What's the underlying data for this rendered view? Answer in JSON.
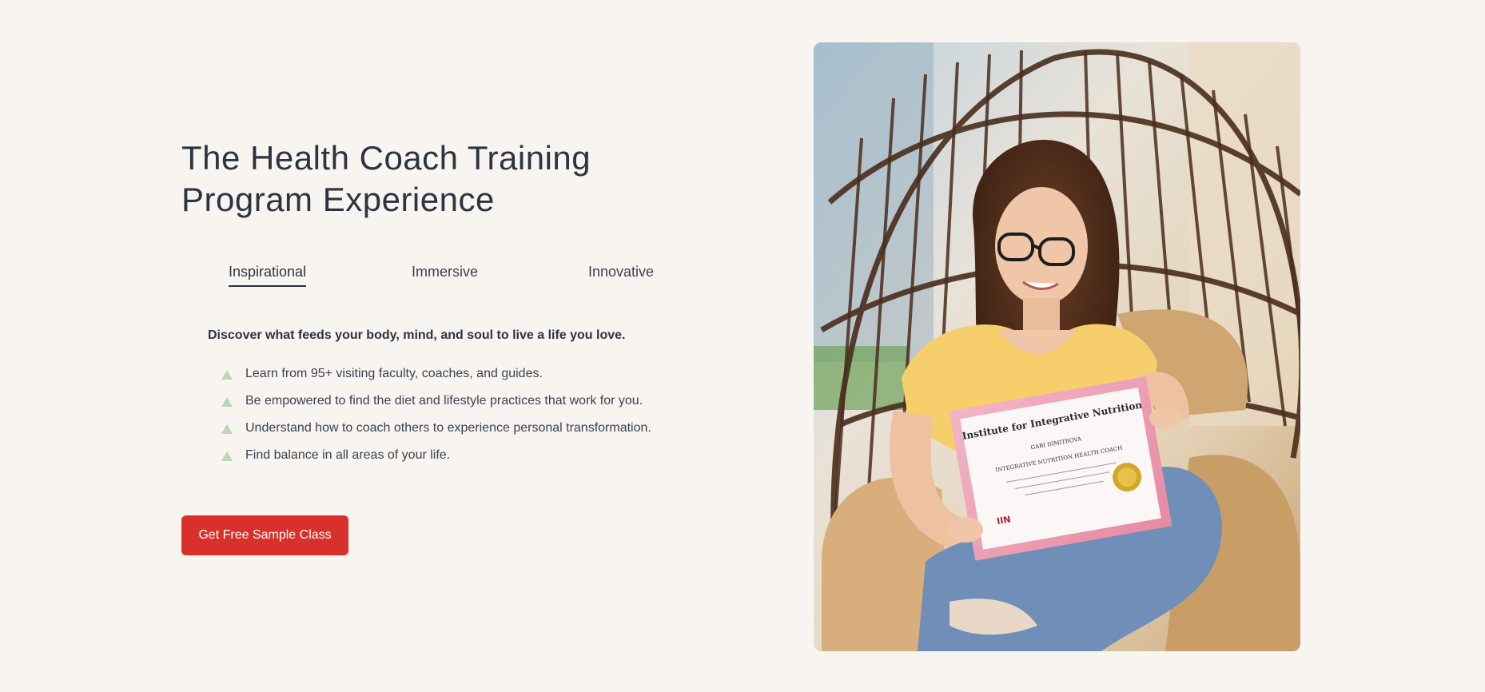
{
  "hero": {
    "title_line1": "The Health Coach Training",
    "title_line2": "Program Experience",
    "tabs": [
      {
        "label": "Inspirational",
        "active": true
      },
      {
        "label": "Immersive",
        "active": false
      },
      {
        "label": "Innovative",
        "active": false
      }
    ],
    "tagline": "Discover what feeds your body, mind, and soul to live a life you love.",
    "bullets": [
      "Learn from 95+ visiting faculty, coaches, and guides.",
      "Be empowered to find the diet and lifestyle practices that work for you.",
      "Understand how to coach others to experience personal transformation.",
      "Find balance in all areas of your life."
    ],
    "cta_label": "Get Free Sample Class"
  },
  "photo": {
    "certificate": {
      "heading": "Institute for Integrative Nutrition",
      "name": "GABI DIMITROVA",
      "title": "INTEGRATIVE NUTRITION HEALTH COACH",
      "logo": "IIN"
    }
  },
  "colors": {
    "background": "#f8f5f1",
    "text": "#2c3441",
    "accent": "#d9302b",
    "bullet": "#b9d6b5"
  }
}
